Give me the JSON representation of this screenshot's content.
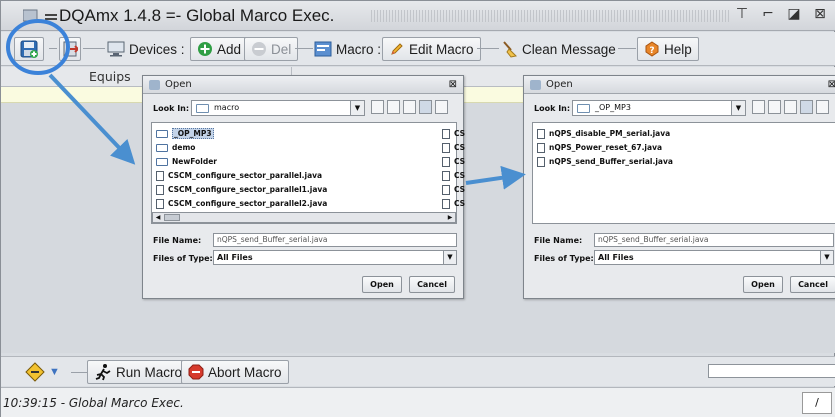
{
  "window": {
    "title": "DQAmx 1.4.8 =- Global Marco Exec."
  },
  "toolbar": {
    "devices": "Devices :",
    "add": "Add",
    "del": "Del",
    "macro": "Macro :",
    "edit_macro": "Edit Macro",
    "clean_message": "Clean Message",
    "help": "Help"
  },
  "panel": {
    "header": "Equips"
  },
  "bottombar": {
    "run_macro": "Run Macro",
    "abort_macro": "Abort Macro"
  },
  "status": {
    "text": "10:39:15 - Global Marco Exec.",
    "right": "/"
  },
  "dialog_left": {
    "title": "Open",
    "look_in_label": "Look In:",
    "look_in_value": "macro",
    "items": [
      {
        "name": "_OP_MP3",
        "type": "folder",
        "selected": true
      },
      {
        "name": "demo",
        "type": "folder"
      },
      {
        "name": "NewFolder",
        "type": "folder"
      },
      {
        "name": "CSCM_configure_sector_parallel.java",
        "type": "file"
      },
      {
        "name": "CSCM_configure_sector_parallel1.java",
        "type": "file"
      },
      {
        "name": "CSCM_configure_sector_parallel2.java",
        "type": "file"
      }
    ],
    "col2_items": [
      "CS",
      "CS",
      "CS",
      "CS",
      "CS",
      "CS"
    ],
    "file_name_label": "File Name:",
    "file_name_value": "nQPS_send_Buffer_serial.java",
    "files_of_type_label": "Files of Type:",
    "files_of_type_value": "All Files",
    "open_button": "Open",
    "cancel_button": "Cancel"
  },
  "dialog_right": {
    "title": "Open",
    "look_in_label": "Look In:",
    "look_in_value": "_OP_MP3",
    "items": [
      {
        "name": "nQPS_disable_PM_serial.java",
        "type": "file"
      },
      {
        "name": "nQPS_Power_reset_67.java",
        "type": "file"
      },
      {
        "name": "nQPS_send_Buffer_serial.java",
        "type": "file"
      }
    ],
    "file_name_label": "File Name:",
    "file_name_value": "nQPS_send_Buffer_serial.java",
    "files_of_type_label": "Files of Type:",
    "files_of_type_value": "All Files",
    "open_button": "Open",
    "cancel_button": "Cancel"
  },
  "colors": {
    "highlight_circle": "#3b82d9",
    "arrow": "#4a8fd0"
  }
}
